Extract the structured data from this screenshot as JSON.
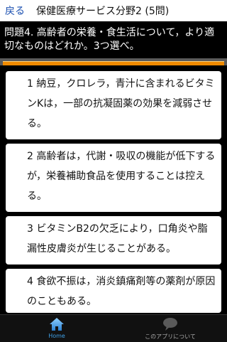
{
  "header": {
    "back_label": "戻る",
    "title": "保健医療サービス分野2 (5問)"
  },
  "question": {
    "text": "問題4. 高齢者の栄養・食生活について，より適切なものはどれか。3つ選べ。"
  },
  "choices": [
    {
      "text": "1 納豆，クロレラ，青汁に含まれるビタミンKは，一部の抗凝固薬の効果を減弱させる。"
    },
    {
      "text": "2 高齢者は，代謝・吸収の機能が低下するが，栄養補助食品を使用することは控える。"
    },
    {
      "text": "3 ビタミンB2の欠乏により，口角炎や脂漏性皮膚炎が生じることがある。"
    },
    {
      "text": "4 食欲不振は，消炎鎮痛剤等の薬剤が原因のこともある。"
    }
  ],
  "nav": {
    "home_label": "Home",
    "about_label": "このアプリについて",
    "home_icon": "home-icon",
    "about_icon": "speech-bubble-icon"
  },
  "colors": {
    "back_link": "#1a4fb0",
    "bar_orange": "#f08a00",
    "home_active": "#3fa0e6"
  }
}
